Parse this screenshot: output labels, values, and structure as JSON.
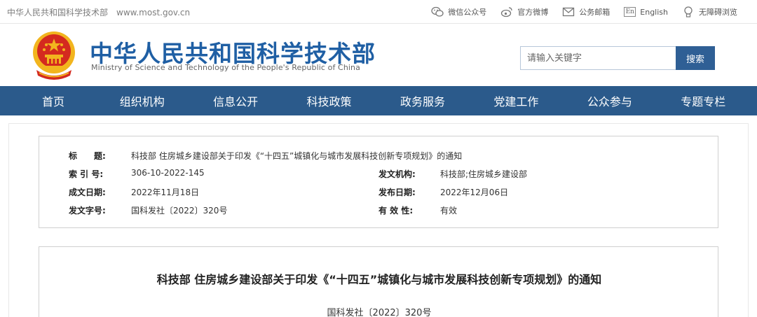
{
  "topbar": {
    "site_name": "中华人民共和国科学技术部",
    "site_url": "www.most.gov.cn",
    "links": [
      {
        "label": "微信公众号",
        "icon": "wechat-icon"
      },
      {
        "label": "官方微博",
        "icon": "weibo-icon"
      },
      {
        "label": "公务邮箱",
        "icon": "mail-icon"
      },
      {
        "label": "English",
        "icon": "english-icon",
        "icon_text": "En"
      },
      {
        "label": "无障碍浏览",
        "icon": "accessibility-icon"
      }
    ]
  },
  "header": {
    "title_cn": "中华人民共和国科学技术部",
    "title_en": "Ministry of Science and Technology of the People's Republic of China",
    "emblem": "national-emblem",
    "search_placeholder": "请输入关键字",
    "search_button": "搜索"
  },
  "nav": {
    "items": [
      "首页",
      "组织机构",
      "信息公开",
      "科技政策",
      "政务服务",
      "党建工作",
      "公众参与",
      "专题专栏"
    ]
  },
  "meta": {
    "title_label": "标　　题:",
    "title_value": "科技部 住房城乡建设部关于印发《“十四五”城镇化与城市发展科技创新专项规划》的通知",
    "index_label": "索 引 号:",
    "index_value": "306-10-2022-145",
    "issuer_label": "发文机构:",
    "issuer_value": "科技部;住房城乡建设部",
    "written_label": "成文日期:",
    "written_value": "2022年11月18日",
    "published_label": "发布日期:",
    "published_value": "2022年12月06日",
    "docno_label": "发文字号:",
    "docno_value": "国科发社〔2022〕320号",
    "validity_label": "有 效 性:",
    "validity_value": "有效"
  },
  "document": {
    "title": "科技部 住房城乡建设部关于印发《“十四五”城镇化与城市发展科技创新专项规划》的通知",
    "doc_number": "国科发社〔2022〕320号"
  },
  "colors": {
    "brand_blue": "#1f5fa4",
    "nav_bg": "#2b5a8b",
    "search_button": "#2f5f95",
    "emblem_red": "#d42a1f",
    "emblem_gold": "#f2b51e"
  }
}
